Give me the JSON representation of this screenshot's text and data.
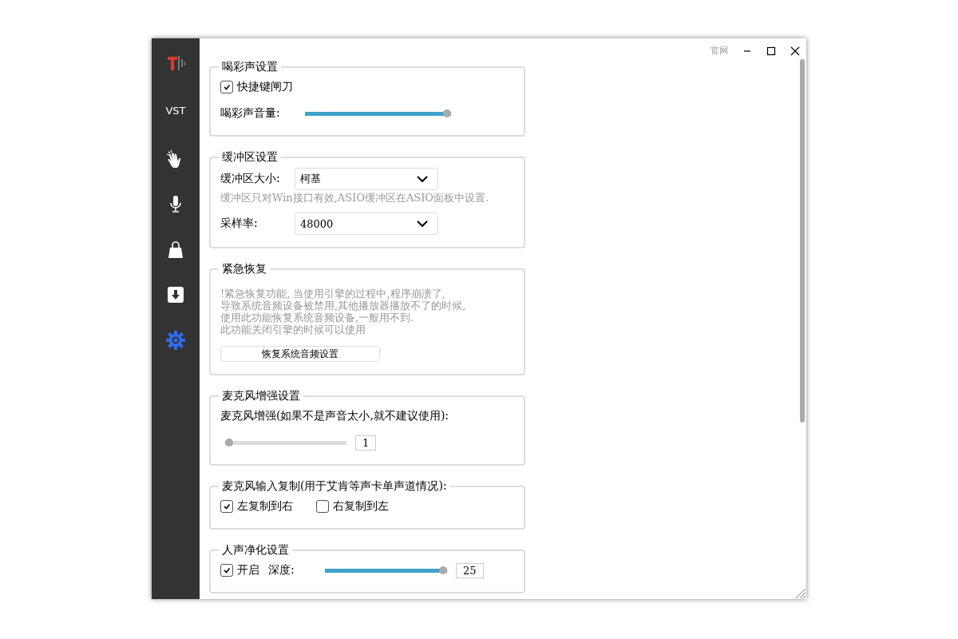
{
  "window": {
    "link": "官网"
  },
  "sidebar": {
    "items": [
      {
        "kind": "logo",
        "selected": false
      },
      {
        "kind": "text",
        "label": "VST",
        "selected": false
      },
      {
        "kind": "clap",
        "selected": false
      },
      {
        "kind": "mic",
        "selected": false
      },
      {
        "kind": "bag",
        "selected": false
      },
      {
        "kind": "download",
        "selected": false
      },
      {
        "kind": "gear",
        "selected": true
      }
    ]
  },
  "sections": [
    {
      "title": "喝彩声设置",
      "rows": [
        {
          "kind": "checkbox",
          "label": "快捷键闸刀",
          "checked": true
        },
        {
          "kind": "slider",
          "label": "喝彩声音量:",
          "level": 1
        }
      ]
    },
    {
      "title": "缓冲区设置",
      "rows": [
        {
          "kind": "select",
          "label": "缓冲区大小:",
          "value": "柯基"
        },
        {
          "kind": "hint",
          "text": "缓冲区只对Win接口有效,ASIO缓冲区在ASIO面板中设置."
        },
        {
          "kind": "select",
          "label": "采样率:",
          "value": "48000"
        }
      ]
    },
    {
      "title": "紧急恢复",
      "rows": [
        {
          "kind": "note",
          "lines": [
            "!紧急恢复功能, 当使用引擎的过程中,程序崩溃了,",
            "导致系统音频设备被禁用,其他播放器播放不了的时候,",
            "使用此功能恢复系统音频设备,一般用不到.",
            "此功能关闭引擎的时候可以使用"
          ]
        },
        {
          "kind": "button",
          "label": "恢复系统音频设置"
        }
      ]
    },
    {
      "title": "麦克风增强设置",
      "rows": [
        {
          "kind": "text",
          "text": "麦克风增强(如果不是声音太小,就不建议使用):"
        },
        {
          "kind": "valueslider",
          "level": 0,
          "value": "1"
        }
      ]
    },
    {
      "title": "麦克风输入复制(用于艾肯等声卡单声道情况):",
      "rows": [
        {
          "kind": "checks",
          "items": [
            {
              "label": "左复制到右",
              "checked": true
            },
            {
              "label": "右复制到左",
              "checked": false
            }
          ]
        }
      ]
    },
    {
      "title": "人声净化设置",
      "rows": [
        {
          "kind": "checkslider",
          "label": "开启",
          "checked": true,
          "label2": "深度:",
          "level": 1,
          "value": "25"
        }
      ]
    }
  ]
}
